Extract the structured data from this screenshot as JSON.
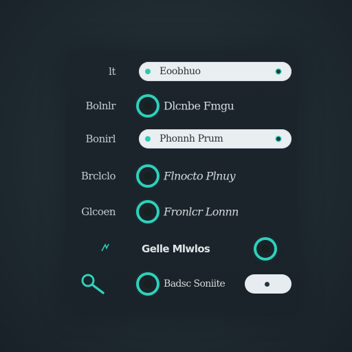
{
  "rows": [
    {
      "label": "lt",
      "field_text": "Eoobhuo"
    },
    {
      "label": "Bolnlr",
      "option_text": "Dlcnbe Fmgu"
    },
    {
      "label": "Bonirl",
      "field_text": "Phonnh Prum"
    },
    {
      "label": "Brclclo",
      "option_text": "Flnocto Plnuy"
    },
    {
      "label": "Glcoen",
      "option_text": "Fronlcr Lonnn"
    },
    {
      "label": "",
      "option_text": "Gelle Mlwlos"
    },
    {
      "label": "",
      "option_text": "Badsc Soniite"
    }
  ],
  "colors": {
    "accent": "#2fd0bb",
    "background": "#1f2a31",
    "field": "#e9eef1",
    "label_text": "#c4ccd0"
  },
  "icons": {
    "row6_icon": "small-leaf-icon",
    "row7_icon": "search-icon"
  }
}
